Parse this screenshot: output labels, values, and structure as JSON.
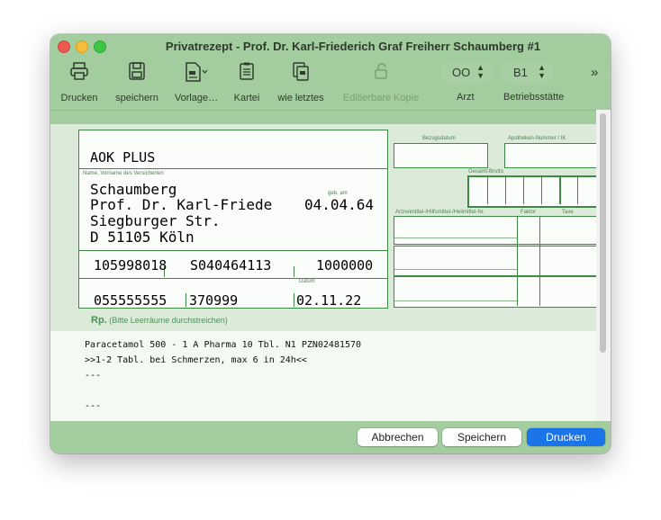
{
  "window": {
    "title": "Privatrezept -  Prof. Dr. Karl-Friederich Graf Freiherr Schaumberg #1"
  },
  "toolbar": {
    "print_label": "Drucken",
    "save_label": "speichern",
    "template_label": "Vorlage…",
    "index_label": "Kartei",
    "last_label": "wie letztes",
    "editable_copy_label": "Editierbare Kopie",
    "doctor_value": "OO",
    "doctor_label": "Arzt",
    "site_value": "B1",
    "site_label": "Betriebsstätte",
    "more": "»"
  },
  "form": {
    "insurer": "AOK PLUS",
    "patient_caption": "Name, Vorname des Versicherten",
    "birth_caption": "geb. am",
    "patient_line1": "Schaumberg",
    "patient_line2": "Prof. Dr. Karl-Friede",
    "birthdate": "04.04.64",
    "street": "Siegburger Str.",
    "city": "D 51105 Köln",
    "kostentraeger": "105998018",
    "versicherten_nr": "S040464113",
    "status": "1000000",
    "betriebsstaette_nr": "055555555",
    "arzt_nr": "370999",
    "date_caption": "Datum",
    "date": "02.11.22",
    "bezugsdatum_caption": "Bezugsdatum",
    "apotheken_caption": "Apotheken-Nummer / IK",
    "gesamt_caption": "Gesamt-Brutto",
    "arznei_caption": "Arzneimittel-/Hilfsmittel-/Heilmittel-Nr.",
    "faktor_caption": "Faktor",
    "taxe_caption": "Taxe",
    "rp_label": "Rp.",
    "rp_hint": "(Bitte Leerräume durchstreichen)"
  },
  "prescription": {
    "line1": "Paracetamol 500 - 1 A Pharma 10 Tbl. N1 PZN02481570",
    "line2": ">>1-2 Tabl. bei Schmerzen, max 6 in 24h<<",
    "line3": "---",
    "line4": "---"
  },
  "buttons": {
    "cancel": "Abbrechen",
    "save": "Speichern",
    "print": "Drucken"
  },
  "colors": {
    "window_green": "#a3cc9f",
    "form_green": "#3e8a45",
    "primary_blue": "#1b75e8"
  }
}
